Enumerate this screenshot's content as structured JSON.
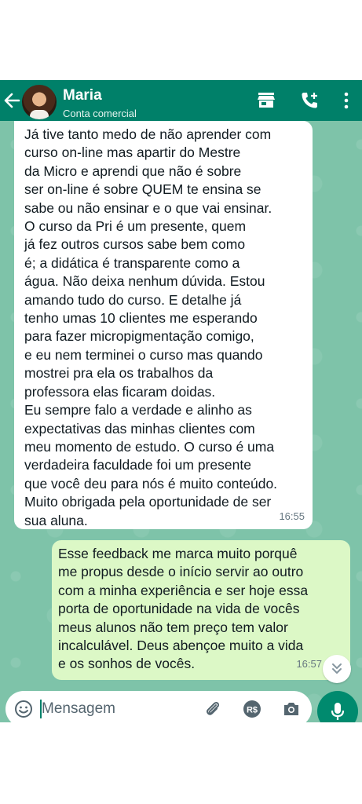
{
  "header": {
    "name": "Maria",
    "subtitle": "Conta comercial",
    "icons": [
      "back-arrow-icon",
      "store-icon",
      "add-call-icon",
      "more-vert-icon"
    ]
  },
  "messages": [
    {
      "direction": "incoming",
      "lines": [
        "Já tive tanto medo de não aprender com",
        "curso on-line mas apartir do Mestre",
        "da Micro e aprendi que não é sobre",
        "ser on-line é sobre QUEM te ensina se",
        "sabe ou não ensinar e o que vai ensinar.",
        "O curso da Pri é um presente, quem",
        "já fez outros cursos sabe bem como",
        "é; a didática é transparente como a",
        "água. Não deixa nenhum dúvida. Estou",
        "amando tudo do curso. E detalhe já",
        "tenho umas 10 clientes me esperando",
        "para fazer micropigmentação comigo,",
        "e eu nem terminei o curso mas quando",
        "mostrei pra ela os trabalhos da",
        "professora elas ficaram doidas.",
        "Eu sempre falo a verdade e alinho as",
        "expectativas das minhas clientes com",
        "meu momento de estudo. O curso é uma",
        "verdadeira faculdade foi um presente",
        "que você deu para nós é muito conteúdo.",
        "Muito obrigada pela oportunidade de ser",
        "sua aluna."
      ],
      "time": "16:55"
    },
    {
      "direction": "outgoing",
      "lines": [
        "Esse feedback me marca muito porquê",
        "me propus desde o início servir ao outro",
        "com a minha experiência e ser hoje essa",
        "porta de oportunidade na vida de vocês",
        "meus alunos não tem preço tem valor",
        "incalculável. Deus abençoe muito a vida",
        "e os sonhos de vocês."
      ],
      "time": "16:57"
    }
  ],
  "input": {
    "placeholder": "Mensagem",
    "icons": [
      "emoji-icon",
      "attach-icon",
      "payment-icon",
      "camera-icon",
      "mic-icon"
    ]
  },
  "colors": {
    "header": "#008069",
    "chat_background": "#7ec3a9",
    "incoming_bubble": "#ffffff",
    "outgoing_bubble": "#dcf8c6",
    "mic_button": "#008a6e"
  }
}
